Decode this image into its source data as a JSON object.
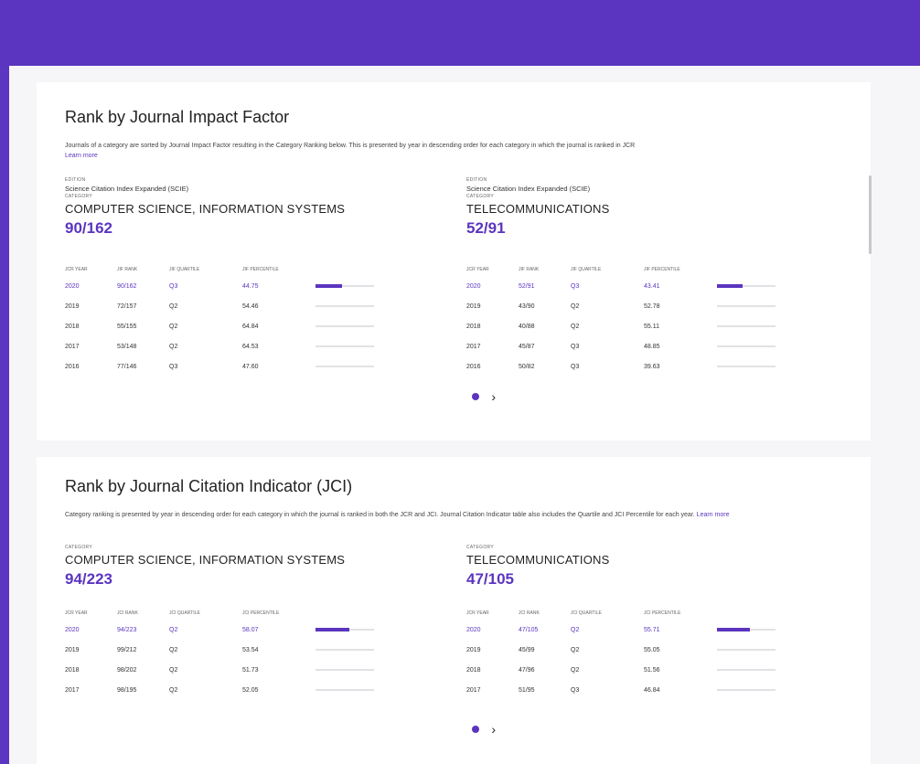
{
  "jif": {
    "title": "Rank by Journal Impact Factor",
    "description": "Journals of a category are sorted by Journal Impact Factor resulting in the Category Ranking below. This is presented by year in descending order for each category in which the journal is ranked in JCR",
    "learn_more": "Learn more",
    "columns": [
      "JCR YEAR",
      "JIF RANK",
      "JIF QUARTILE",
      "JIF PERCENTILE"
    ],
    "categories": [
      {
        "edition_label": "EDITION",
        "edition": "Science Citation Index Expanded (SCIE)",
        "category_label": "CATEGORY",
        "name": "COMPUTER SCIENCE, INFORMATION SYSTEMS",
        "rank": "90/162",
        "rows": [
          {
            "year": "2020",
            "rank": "90/162",
            "quartile": "Q3",
            "percentile": "44.75",
            "pct": 0.4475
          },
          {
            "year": "2019",
            "rank": "72/157",
            "quartile": "Q2",
            "percentile": "54.46",
            "pct": 0.5446
          },
          {
            "year": "2018",
            "rank": "55/155",
            "quartile": "Q2",
            "percentile": "64.84",
            "pct": 0.6484
          },
          {
            "year": "2017",
            "rank": "53/148",
            "quartile": "Q2",
            "percentile": "64.53",
            "pct": 0.6453
          },
          {
            "year": "2016",
            "rank": "77/146",
            "quartile": "Q3",
            "percentile": "47.60",
            "pct": 0.476
          }
        ]
      },
      {
        "edition_label": "EDITION",
        "edition": "Science Citation Index Expanded (SCIE)",
        "category_label": "CATEGORY",
        "name": "TELECOMMUNICATIONS",
        "rank": "52/91",
        "rows": [
          {
            "year": "2020",
            "rank": "52/91",
            "quartile": "Q3",
            "percentile": "43.41",
            "pct": 0.4341
          },
          {
            "year": "2019",
            "rank": "43/90",
            "quartile": "Q2",
            "percentile": "52.78",
            "pct": 0.5278
          },
          {
            "year": "2018",
            "rank": "40/88",
            "quartile": "Q2",
            "percentile": "55.11",
            "pct": 0.5511
          },
          {
            "year": "2017",
            "rank": "45/87",
            "quartile": "Q3",
            "percentile": "48.85",
            "pct": 0.4885
          },
          {
            "year": "2016",
            "rank": "50/82",
            "quartile": "Q3",
            "percentile": "39.63",
            "pct": 0.3963
          }
        ]
      }
    ]
  },
  "jci": {
    "title": "Rank by Journal Citation Indicator (JCI)",
    "description": "Category ranking is presented by year in descending order for each category in which the journal is ranked in both the JCR and JCI. Journal Citation Indicator table also includes the Quartile and JCI Percentile for each year.",
    "learn_more": "Learn more",
    "columns": [
      "JCR YEAR",
      "JCI RANK",
      "JCI QUARTILE",
      "JCI PERCENTILE"
    ],
    "categories": [
      {
        "category_label": "CATEGORY",
        "name": "COMPUTER SCIENCE, INFORMATION SYSTEMS",
        "rank": "94/223",
        "rows": [
          {
            "year": "2020",
            "rank": "94/223",
            "quartile": "Q2",
            "percentile": "58.07",
            "pct": 0.5807
          },
          {
            "year": "2019",
            "rank": "99/212",
            "quartile": "Q2",
            "percentile": "53.54",
            "pct": 0.5354
          },
          {
            "year": "2018",
            "rank": "98/202",
            "quartile": "Q2",
            "percentile": "51.73",
            "pct": 0.5173
          },
          {
            "year": "2017",
            "rank": "98/195",
            "quartile": "Q2",
            "percentile": "52.05",
            "pct": 0.5205
          }
        ]
      },
      {
        "category_label": "CATEGORY",
        "name": "TELECOMMUNICATIONS",
        "rank": "47/105",
        "rows": [
          {
            "year": "2020",
            "rank": "47/105",
            "quartile": "Q2",
            "percentile": "55.71",
            "pct": 0.5571
          },
          {
            "year": "2019",
            "rank": "45/99",
            "quartile": "Q2",
            "percentile": "55.05",
            "pct": 0.5505
          },
          {
            "year": "2018",
            "rank": "47/96",
            "quartile": "Q2",
            "percentile": "51.56",
            "pct": 0.5156
          },
          {
            "year": "2017",
            "rank": "51/95",
            "quartile": "Q3",
            "percentile": "46.84",
            "pct": 0.4684
          }
        ]
      }
    ]
  },
  "pager": {
    "next_icon": "chevron-right-icon",
    "dot_icon": "page-dot-icon"
  },
  "colors": {
    "accent": "#5b35c0",
    "header": "#5b35c0",
    "bar_track": "#e2e2e6"
  }
}
